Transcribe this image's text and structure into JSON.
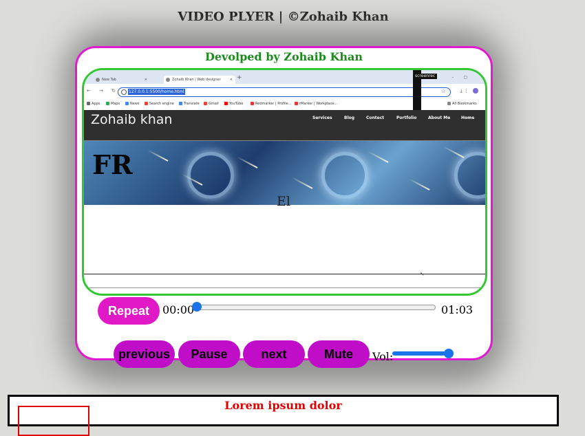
{
  "page": {
    "title": "VIDEO PLYER | ©Zohaib Khan"
  },
  "player": {
    "developer": "Devolped by Zohaib Khan",
    "current_time": "00:00",
    "duration": "01:03",
    "seek_progress": 0,
    "volume_level": 1,
    "volume_label": "Vol:",
    "buttons": {
      "repeat": "Repeat",
      "previous": "previous",
      "pause": "Pause",
      "next": "next",
      "mute": "Mute"
    },
    "accent_color": "#e219d0",
    "button_color": "#c00ec8"
  },
  "video_frame": {
    "tabs": [
      {
        "label": "New Tab",
        "close": "×"
      },
      {
        "label": "Zohaib Khan | Web designer",
        "close": "×"
      }
    ],
    "new_tab": "+",
    "window_controls": "–  ▢",
    "nav_buttons": "← → ↻",
    "url": "127.0.0.1:5500/home.html",
    "rec_label": "screenrec",
    "right_icons": "⤓ ⋮",
    "bookmarks": [
      "Apps",
      "Maps",
      "News",
      "Search engine",
      "Translate",
      "Gmail",
      "YouTube",
      "Redmarker | Profile...",
      "rMarker | Workplace...",
      "All Bookmarks"
    ],
    "site_logo": "Zohaib khan",
    "site_links": [
      "Services",
      "Blog",
      "Contect",
      "Portfolio",
      "About Me",
      "Home"
    ],
    "hero_text": "FR",
    "body_text": "El"
  },
  "bottom": {
    "heading": "Lorem ipsum dolor"
  }
}
